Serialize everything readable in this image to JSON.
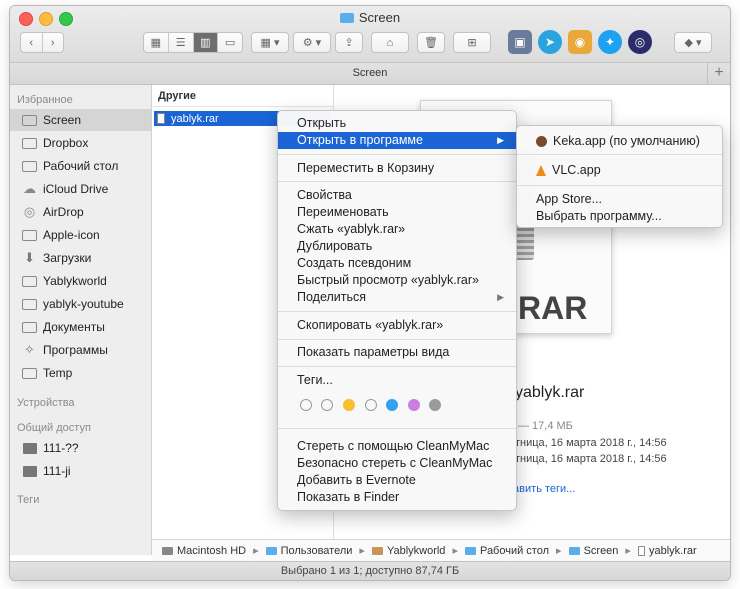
{
  "window": {
    "title": "Screen",
    "tab_title": "Screen",
    "status_text": "Выбрано 1 из 1; доступно 87,74 ГБ"
  },
  "icons": [
    "back-icon",
    "forward-icon",
    "icon-view-icon",
    "list-view-icon",
    "column-view-icon",
    "coverflow-view-icon",
    "group-icon",
    "gear-icon",
    "share-icon",
    "tag-icon",
    "trash-icon",
    "new-folder-icon",
    "dropbox-icon"
  ],
  "sidebar": {
    "favorites_title": "Избранное",
    "favorites": [
      {
        "label": "Screen",
        "icon": "folder-icon",
        "selected": true
      },
      {
        "label": "Dropbox",
        "icon": "folder-icon"
      },
      {
        "label": "Рабочий стол",
        "icon": "folder-icon"
      },
      {
        "label": "iCloud Drive",
        "icon": "cloud-icon"
      },
      {
        "label": "AirDrop",
        "icon": "airdrop-icon"
      },
      {
        "label": "Apple-icon",
        "icon": "folder-icon"
      },
      {
        "label": "Загрузки",
        "icon": "download-icon"
      },
      {
        "label": "Yablykworld",
        "icon": "folder-icon"
      },
      {
        "label": "yablyk-youtube",
        "icon": "folder-icon"
      },
      {
        "label": "Документы",
        "icon": "document-icon"
      },
      {
        "label": "Программы",
        "icon": "applications-icon"
      },
      {
        "label": "Temp",
        "icon": "folder-icon"
      }
    ],
    "devices_title": "Устройства",
    "shared_title": "Общий доступ",
    "shared": [
      {
        "label": "111-??",
        "icon": "computer-icon"
      },
      {
        "label": "111-ji",
        "icon": "computer-icon"
      }
    ],
    "tags_title": "Теги"
  },
  "column": {
    "header": "Другие",
    "file_name": "yablyk.rar"
  },
  "preview": {
    "badge": "RAR",
    "name": "yablyk.rar",
    "size": "— 17,4 МБ",
    "created": "тница, 16 марта 2018 г., 14:56",
    "modified": "тница, 16 марта 2018 г., 14:56",
    "link": "бавить теги..."
  },
  "pathbar": [
    "Macintosh HD",
    "Пользователи",
    "Yablykworld",
    "Рабочий стол",
    "Screen",
    "yablyk.rar"
  ],
  "context_menu": {
    "open": "Открыть",
    "open_with": "Открыть в программе",
    "move_trash": "Переместить в Корзину",
    "properties": "Свойства",
    "rename": "Переименовать",
    "compress": "Сжать «yablyk.rar»",
    "duplicate": "Дублировать",
    "alias": "Создать псевдоним",
    "quicklook": "Быстрый просмотр «yablyk.rar»",
    "share": "Поделиться",
    "copy": "Скопировать «yablyk.rar»",
    "view_options": "Показать параметры вида",
    "tags": "Теги...",
    "tag_colors": [
      "#ffffff",
      "#ffffff",
      "#f5c02b",
      "#ffffff",
      "#33a1ee",
      "#c97ee0",
      "#9a9a9a"
    ],
    "cm_erase": "Стереть с помощью CleanMyMac",
    "cm_secure": "Безопасно стереть с CleanMyMac",
    "evernote": "Добавить в Evernote",
    "show_finder": "Показать в Finder"
  },
  "submenu": {
    "keka": "Keka.app (по умолчанию)",
    "vlc": "VLC.app",
    "appstore": "App Store...",
    "choose": "Выбрать программу..."
  }
}
